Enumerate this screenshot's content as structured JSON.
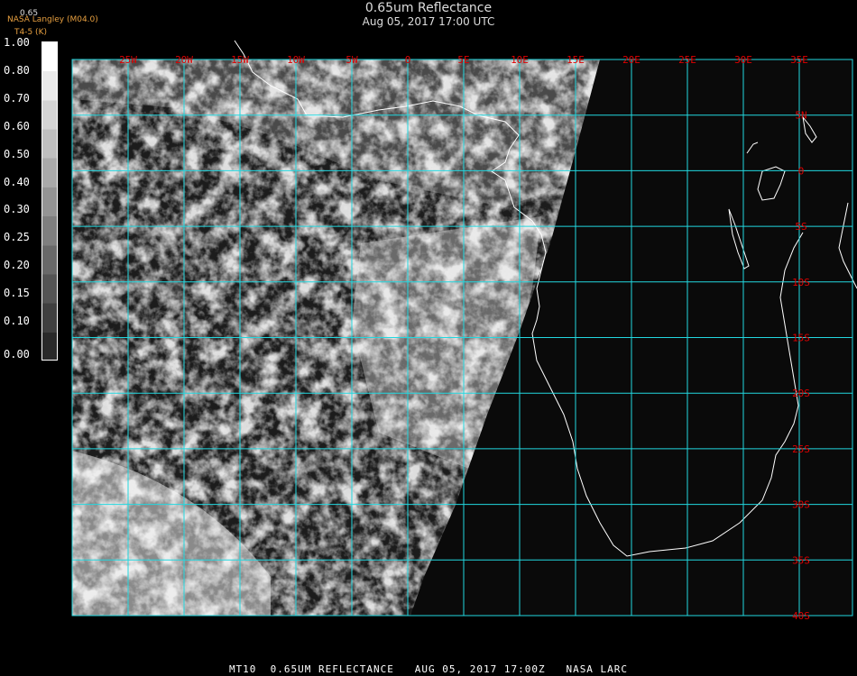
{
  "header": {
    "title": "0.65um Reflectance",
    "subtitle": "Aug 05, 2017 17:00 UTC",
    "credit": "NASA Langley (M04.0)",
    "colorbar_title": "0.65",
    "colorbar_unit": "T4-5 (K)"
  },
  "colorbar": {
    "labels": [
      "1.00",
      "0.80",
      "0.70",
      "0.60",
      "0.50",
      "0.40",
      "0.30",
      "0.25",
      "0.20",
      "0.15",
      "0.10",
      "0.00"
    ]
  },
  "map": {
    "lon_labels": [
      "25W",
      "20W",
      "15W",
      "10W",
      "5W",
      "0",
      "5E",
      "10E",
      "15E",
      "20E",
      "25E",
      "30E",
      "35E"
    ],
    "lat_labels": [
      "5N",
      "0",
      "5S",
      "10S",
      "15S",
      "20S",
      "25S",
      "30S",
      "35S",
      "40S"
    ],
    "grid_color": "#22d8e0",
    "label_color": "#e00000",
    "coast_color": "#ffffff"
  },
  "footer": {
    "text": "MT10  0.65UM REFLECTANCE   AUG 05, 2017 17:00Z   NASA LARC"
  }
}
